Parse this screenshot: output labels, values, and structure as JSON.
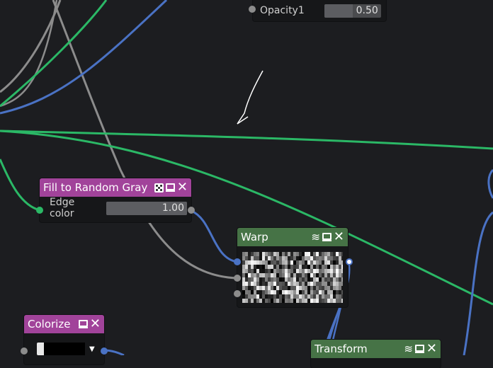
{
  "colors": {
    "background": "#1c1d20",
    "purple_header": "#a1439a",
    "green_header": "#467346",
    "wire_green": "#2bb866",
    "wire_blue": "#4a72c4",
    "wire_gray": "#8c8c8c"
  },
  "nodes": {
    "opacity_node": {
      "param_label": "Opacity1",
      "param_value": "0.50",
      "param_fraction": 0.5
    },
    "fill_node": {
      "title": "Fill to Random Gray",
      "icons": [
        "dice-icon",
        "monitor-icon",
        "close-icon"
      ],
      "param_label": "Edge color",
      "param_value": "1.00",
      "param_fraction": 1.0
    },
    "warp_node": {
      "title": "Warp",
      "icons": [
        "layers-add-icon",
        "monitor-icon",
        "close-icon"
      ],
      "preview": "noise-preview"
    },
    "colorize_node": {
      "title": "Colorize",
      "icons": [
        "monitor-icon",
        "close-icon"
      ],
      "color_swatch": "#000000"
    },
    "transform_node": {
      "title": "Transform",
      "icons": [
        "layers-add-icon",
        "monitor-icon",
        "close-icon"
      ]
    }
  }
}
